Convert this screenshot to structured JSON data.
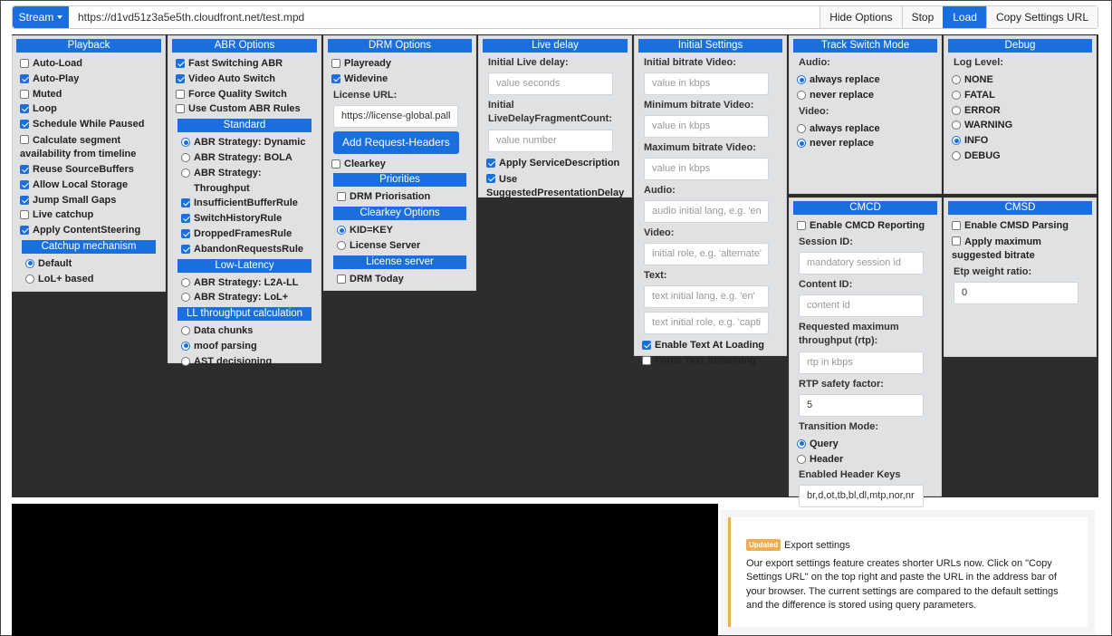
{
  "topbar": {
    "stream_label": "Stream",
    "url": "https://d1vd51z3a5e5th.cloudfront.net/test.mpd",
    "hide_options": "Hide Options",
    "stop": "Stop",
    "load": "Load",
    "copy_settings_url": "Copy Settings URL"
  },
  "playback": {
    "title": "Playback",
    "auto_load": "Auto-Load",
    "auto_play": "Auto-Play",
    "muted": "Muted",
    "loop": "Loop",
    "schedule_while_paused": "Schedule While Paused",
    "calculate_segment": "Calculate segment availability from timeline",
    "reuse_source_buffers": "Reuse SourceBuffers",
    "allow_local_storage": "Allow Local Storage",
    "jump_small_gaps": "Jump Small Gaps",
    "live_catchup": "Live catchup",
    "apply_content_steering": "Apply ContentSteering",
    "catchup_mechanism": "Catchup mechanism",
    "default": "Default",
    "lol_based": "LoL+ based"
  },
  "abr": {
    "title": "ABR Options",
    "fast_switching": "Fast Switching ABR",
    "video_auto_switch": "Video Auto Switch",
    "force_quality_switch": "Force Quality Switch",
    "use_custom_abr_rules": "Use Custom ABR Rules",
    "standard": "Standard",
    "strategy_dynamic": "ABR Strategy: Dynamic",
    "strategy_bola": "ABR Strategy: BOLA",
    "strategy_throughput": "ABR Strategy: Throughput",
    "insufficient_buffer_rule": "InsufficientBufferRule",
    "switch_history_rule": "SwitchHistoryRule",
    "dropped_frames_rule": "DroppedFramesRule",
    "abandon_requests_rule": "AbandonRequestsRule",
    "low_latency": "Low-Latency",
    "strategy_l2a": "ABR Strategy: L2A-LL",
    "strategy_lolp": "ABR Strategy: LoL+",
    "ll_throughput": "LL throughput calculation",
    "data_chunks": "Data chunks",
    "moof_parsing": "moof parsing",
    "ast_decisioning": "AST decisioning"
  },
  "drm": {
    "title": "DRM Options",
    "playready": "Playready",
    "widevine": "Widevine",
    "license_url_label": "License URL:",
    "license_url_value": "https://license-global.pall",
    "add_request_headers": "Add Request-Headers",
    "clearkey": "Clearkey",
    "priorities": "Priorities",
    "drm_priorisation": "DRM Priorisation",
    "clearkey_options": "Clearkey Options",
    "kid_key": "KID=KEY",
    "license_server": "License Server",
    "license_server_header": "License server",
    "drm_today": "DRM Today"
  },
  "live_delay": {
    "title": "Live delay",
    "initial_live_delay_label": "Initial Live delay:",
    "initial_live_delay_placeholder": "value seconds",
    "fragment_count_label": "Initial LiveDelayFragmentCount:",
    "fragment_count_placeholder": "value number",
    "apply_service_description": "Apply ServiceDescription",
    "use_suggested_delay": "Use SuggestedPresentationDelay"
  },
  "initial_settings": {
    "title": "Initial Settings",
    "initial_bitrate_label": "Initial bitrate Video:",
    "initial_bitrate_placeholder": "value in kbps",
    "min_bitrate_label": "Minimum bitrate Video:",
    "min_bitrate_placeholder": "value in kbps",
    "max_bitrate_label": "Maximum bitrate Video:",
    "max_bitrate_placeholder": "value in kbps",
    "audio_label": "Audio:",
    "audio_placeholder": "audio initial lang, e.g. 'en",
    "video_label": "Video:",
    "video_placeholder": "initial role, e.g. 'alternate'",
    "text_label": "Text:",
    "text_lang_placeholder": "text initial lang, e.g. 'en'",
    "text_role_placeholder": "text initial role, e.g. 'capti",
    "enable_text_at_loading": "Enable Text At Loading",
    "force_text_streaming": "Force Text Streaming"
  },
  "track_switch": {
    "title": "Track Switch Mode",
    "audio_label": "Audio:",
    "audio_always": "always replace",
    "audio_never": "never replace",
    "video_label": "Video:",
    "video_always": "always replace",
    "video_never": "never replace"
  },
  "debug": {
    "title": "Debug",
    "log_level_label": "Log Level:",
    "none": "NONE",
    "fatal": "FATAL",
    "error": "ERROR",
    "warning": "WARNING",
    "info": "INFO",
    "debug": "DEBUG"
  },
  "cmcd": {
    "title": "CMCD",
    "enable_reporting": "Enable CMCD Reporting",
    "session_id_label": "Session ID:",
    "session_id_placeholder": "mandatory session id",
    "content_id_label": "Content ID:",
    "content_id_placeholder": "content id",
    "rtp_label": "Requested maximum throughput (rtp):",
    "rtp_placeholder": "rtp in kbps",
    "rtp_safety_label": "RTP safety factor:",
    "rtp_safety_value": "5",
    "transition_mode_label": "Transition Mode:",
    "query": "Query",
    "header": "Header",
    "enabled_keys_label": "Enabled Header Keys",
    "enabled_keys_value": "br,d,ot,tb,bl,dl,mtp,nor,nr"
  },
  "cmsd": {
    "title": "CMSD",
    "enable_parsing": "Enable CMSD Parsing",
    "apply_max_bitrate": "Apply maximum suggested bitrate",
    "etp_weight_label": "Etp weight ratio:",
    "etp_weight_value": "0"
  },
  "notice": {
    "badge": "Updated",
    "title": "Export settings",
    "text": "Our export settings feature creates shorter URLs now. Click on \"Copy Settings URL\" on the top right and paste the URL in the address bar of your browser. The current settings are compared to the default settings and the difference is stored using query parameters."
  },
  "colors": {
    "accent": "#1a6fe0",
    "panel_bg": "#dfe1e3",
    "dark_area": "#2d2d2d",
    "badge": "#f0ad4e"
  }
}
